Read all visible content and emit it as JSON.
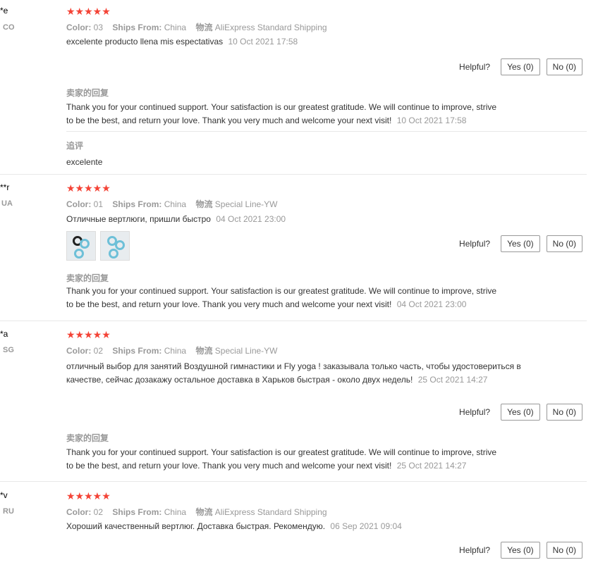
{
  "reviews": [
    {
      "user": "*e",
      "country": "CO",
      "stars": "★★★★★",
      "color_label": "Color:",
      "color": "03",
      "ships_label": "Ships From:",
      "ships_from": "China",
      "logistics_label": "物流",
      "logistics": "AliExpress Standard Shipping",
      "text": "excelente producto llena mis espectativas",
      "date": "10 Oct 2021 17:58",
      "helpful_label": "Helpful?",
      "yes_label": "Yes (0)",
      "no_label": "No (0)",
      "seller_label": "卖家的回复",
      "seller_reply": "Thank you for your continued support. Your satisfaction is our greatest gratitude. We will continue to improve, strive to be the best, and return your love. Thank you very much and welcome your next visit!",
      "reply_date": "10 Oct 2021 17:58",
      "followup_label": "追评",
      "followup_text": "excelente"
    },
    {
      "user": "**r",
      "country": "UA",
      "stars": "★★★★★",
      "color_label": "Color:",
      "color": "01",
      "ships_label": "Ships From:",
      "ships_from": "China",
      "logistics_label": "物流",
      "logistics": "Special Line-YW",
      "text": "Отличные вертлюги, пришли быстро",
      "date": "04 Oct 2021 23:00",
      "helpful_label": "Helpful?",
      "yes_label": "Yes (0)",
      "no_label": "No (0)",
      "seller_label": "卖家的回复",
      "seller_reply": "Thank you for your continued support. Your satisfaction is our greatest gratitude. We will continue to improve, strive to be the best, and return your love. Thank you very much and welcome your next visit!",
      "reply_date": "04 Oct 2021 23:00"
    },
    {
      "user": "*a",
      "country": "SG",
      "stars": "★★★★★",
      "color_label": "Color:",
      "color": "02",
      "ships_label": "Ships From:",
      "ships_from": "China",
      "logistics_label": "物流",
      "logistics": "Special Line-YW",
      "text": "отличный выбор для занятий Воздушной гимнастики и Fly yoga ! заказывала только часть, чтобы удостовериться в качестве, сейчас дозакажу остальное доставка в Харьков быстрая - около двух недель!",
      "date": "25 Oct 2021 14:27",
      "helpful_label": "Helpful?",
      "yes_label": "Yes (0)",
      "no_label": "No (0)",
      "seller_label": "卖家的回复",
      "seller_reply": "Thank you for your continued support. Your satisfaction is our greatest gratitude. We will continue to improve, strive to be the best, and return your love. Thank you very much and welcome your next visit!",
      "reply_date": "25 Oct 2021 14:27"
    },
    {
      "user": "*v",
      "country": "RU",
      "stars": "★★★★★",
      "color_label": "Color:",
      "color": "02",
      "ships_label": "Ships From:",
      "ships_from": "China",
      "logistics_label": "物流",
      "logistics": "AliExpress Standard Shipping",
      "text": "Хороший качественный вертлюг. Доставка быстрая. Рекомендую.",
      "date": "06 Sep 2021 09:04",
      "helpful_label": "Helpful?",
      "yes_label": "Yes (0)",
      "no_label": "No (0)"
    }
  ],
  "colors": {
    "star": "#f44336",
    "muted": "#999999",
    "text": "#333333",
    "border": "#e8e8e8"
  }
}
